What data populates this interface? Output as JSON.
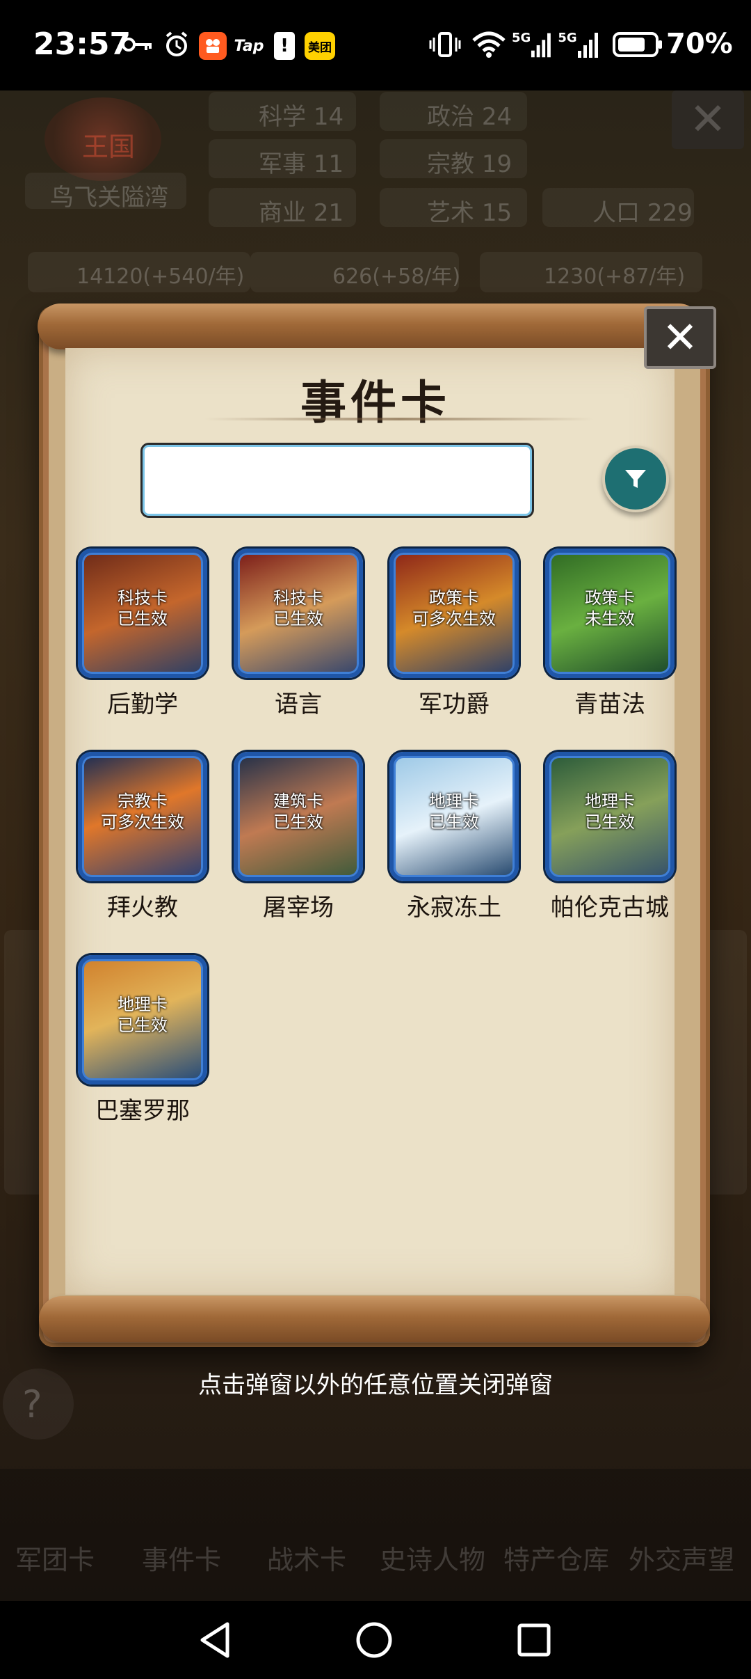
{
  "status_bar": {
    "time": "23:57",
    "apps": [
      {
        "name": "key-icon",
        "label": ""
      },
      {
        "name": "alarm-icon",
        "label": ""
      },
      {
        "name": "app-icon-kuaishou",
        "label": "",
        "color": "#ff5a1f"
      },
      {
        "name": "app-icon-tap",
        "label": "Tap"
      },
      {
        "name": "app-icon-notice",
        "label": "!"
      },
      {
        "name": "app-icon-meituan",
        "label": "美团",
        "color": "#ffd100"
      }
    ],
    "network": [
      "5G",
      "5G"
    ],
    "battery": "70%"
  },
  "background": {
    "kingdom_badge": "王国",
    "location": "鸟飞关隘湾",
    "stats": [
      {
        "label": "科学",
        "value": "14"
      },
      {
        "label": "政治",
        "value": "24"
      },
      {
        "label": "军事",
        "value": "11"
      },
      {
        "label": "宗教",
        "value": "19"
      },
      {
        "label": "商业",
        "value": "21"
      },
      {
        "label": "艺术",
        "value": "15"
      },
      {
        "label": "人口",
        "value": "229"
      }
    ],
    "resources": [
      "14120(+540/年)",
      "626(+58/年)",
      "1230(+87/年)"
    ],
    "bottom_nav": [
      "军团卡",
      "事件卡",
      "战术卡",
      "史诗人物",
      "特产仓库",
      "外交声望"
    ]
  },
  "modal": {
    "title": "事件卡",
    "search_placeholder": "",
    "cards": [
      {
        "name": "后勤学",
        "type": "科技卡",
        "status": "已生效",
        "colors": [
          "#6d2a18",
          "#c4662c",
          "#2b3f66"
        ]
      },
      {
        "name": "语言",
        "type": "科技卡",
        "status": "已生效",
        "colors": [
          "#7a1b18",
          "#d59b5a",
          "#34456d"
        ]
      },
      {
        "name": "军功爵",
        "type": "政策卡",
        "status": "可多次生效",
        "colors": [
          "#8c2418",
          "#d58a2a",
          "#2a3f6a"
        ]
      },
      {
        "name": "青苗法",
        "type": "政策卡",
        "status": "未生效",
        "colors": [
          "#2f6a24",
          "#6ab040",
          "#1d4a2a"
        ]
      },
      {
        "name": "拜火教",
        "type": "宗教卡",
        "status": "可多次生效",
        "colors": [
          "#1c2d54",
          "#e0772a",
          "#2c3f72"
        ]
      },
      {
        "name": "屠宰场",
        "type": "建筑卡",
        "status": "已生效",
        "colors": [
          "#233049",
          "#c07a52",
          "#3c5a3a"
        ]
      },
      {
        "name": "永寂冻土",
        "type": "地理卡",
        "status": "已生效",
        "colors": [
          "#9cc8e6",
          "#e6f2fa",
          "#23466c"
        ]
      },
      {
        "name": "帕伦克古城",
        "type": "地理卡",
        "status": "已生效",
        "colors": [
          "#2a5a3a",
          "#86a05a",
          "#34506a"
        ]
      },
      {
        "name": "巴塞罗那",
        "type": "地理卡",
        "status": "已生效",
        "colors": [
          "#d0802c",
          "#e2b45a",
          "#234a7a"
        ]
      }
    ]
  },
  "hint": "点击弹窗以外的任意位置关闭弹窗"
}
